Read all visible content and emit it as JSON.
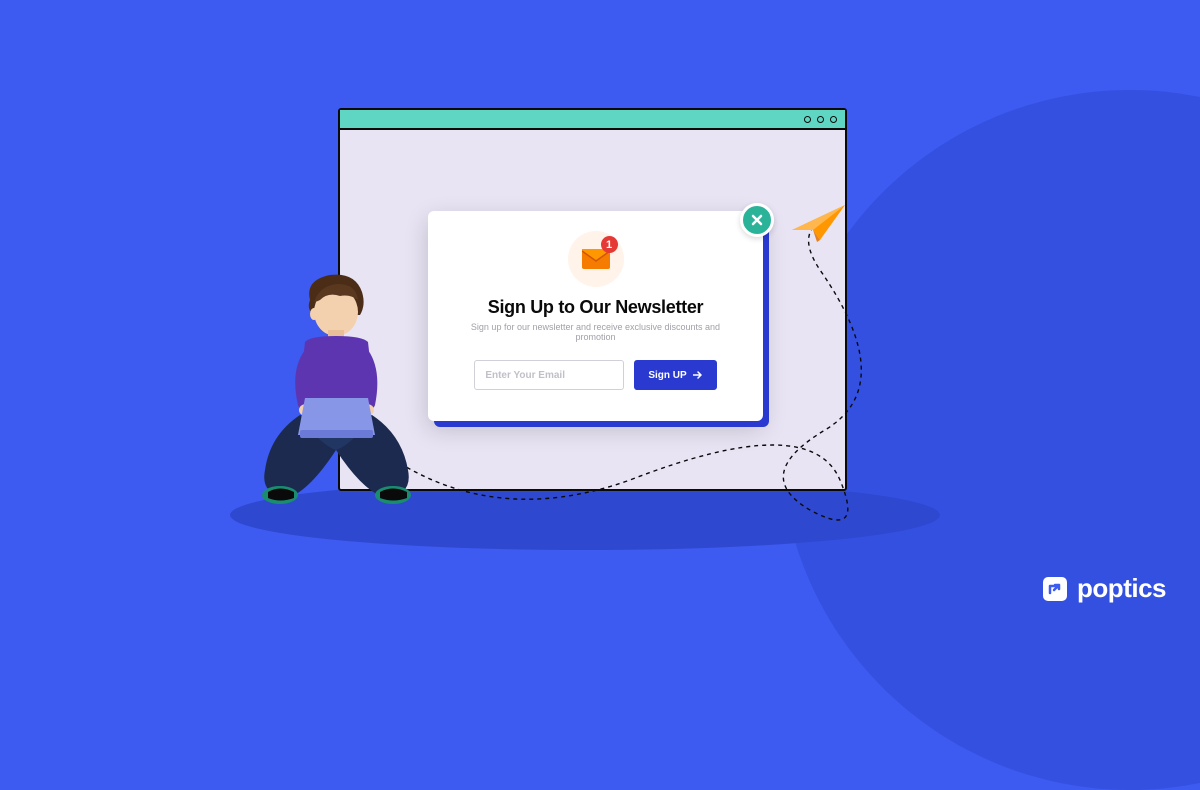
{
  "popup": {
    "title": "Sign Up to Our Newsletter",
    "subtitle": "Sign up for our newsletter and receive exclusive discounts and promotion",
    "badge_count": "1",
    "email_placeholder": "Enter Your Email",
    "signup_label": "Sign UP"
  },
  "brand": {
    "name": "poptics"
  }
}
